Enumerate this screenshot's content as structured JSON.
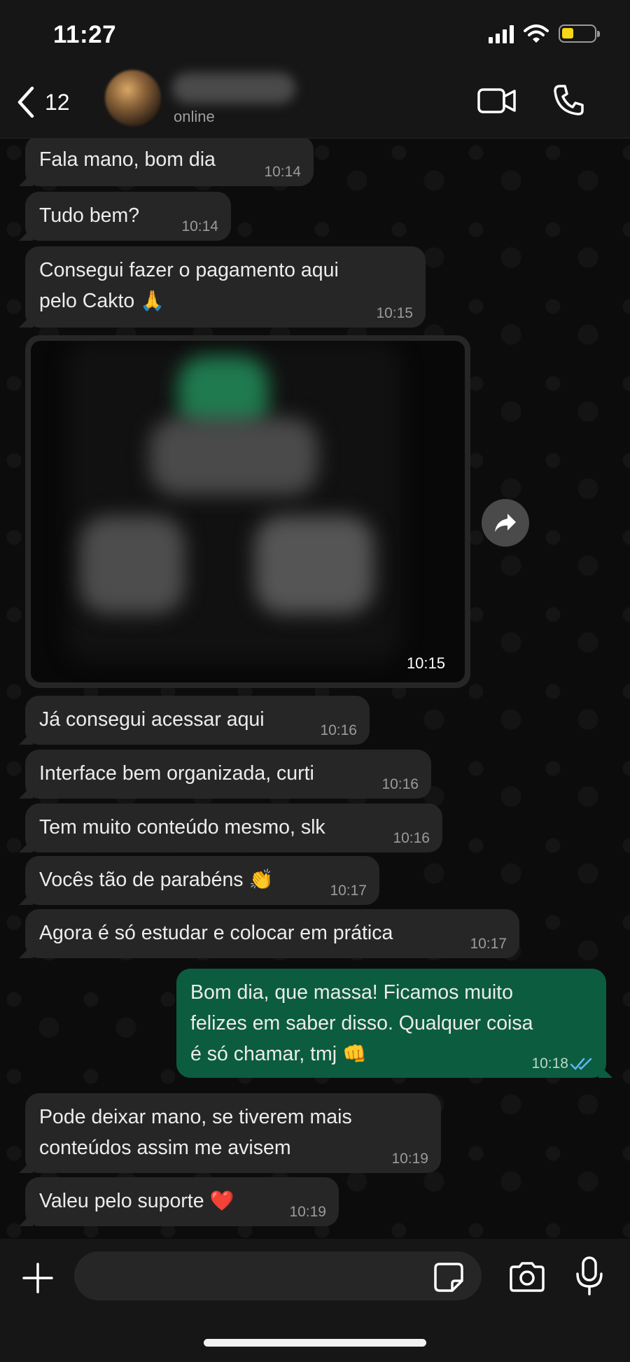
{
  "status_bar": {
    "time": "11:27"
  },
  "header": {
    "back_count": "12",
    "contact_status": "online"
  },
  "messages": [
    {
      "text": "Fala mano, bom dia",
      "time": "10:14"
    },
    {
      "text": "Tudo bem?",
      "time": "10:14"
    },
    {
      "text_line1": "Consegui fazer o pagamento aqui",
      "text_line2": "pelo Cakto",
      "emoji": "🙏",
      "time": "10:15"
    },
    {
      "type": "image",
      "time": "10:15"
    },
    {
      "text": "Já consegui acessar aqui",
      "time": "10:16"
    },
    {
      "text": "Interface bem organizada, curti",
      "time": "10:16"
    },
    {
      "text": "Tem muito conteúdo mesmo, slk",
      "time": "10:16"
    },
    {
      "text": "Vocês tão de parabéns",
      "emoji": "👏",
      "time": "10:17"
    },
    {
      "text": "Agora é só estudar e colocar em prática",
      "time": "10:17"
    },
    {
      "text_line1": "Bom dia, que massa! Ficamos muito",
      "text_line2": "felizes em saber disso. Qualquer coisa",
      "text_line3": "é só chamar, tmj",
      "emoji": "👊",
      "time": "10:18",
      "outgoing": true
    },
    {
      "text_line1": "Pode deixar mano, se tiverem mais",
      "text_line2": "conteúdos assim me avisem",
      "time": "10:19"
    },
    {
      "text": "Valeu pelo suporte",
      "emoji": "❤️",
      "time": "10:19"
    }
  ],
  "colors": {
    "incoming_bubble": "#262626",
    "outgoing_bubble": "#0c5c3f",
    "background": "#0c0c0c",
    "battery": "#f7d617"
  }
}
